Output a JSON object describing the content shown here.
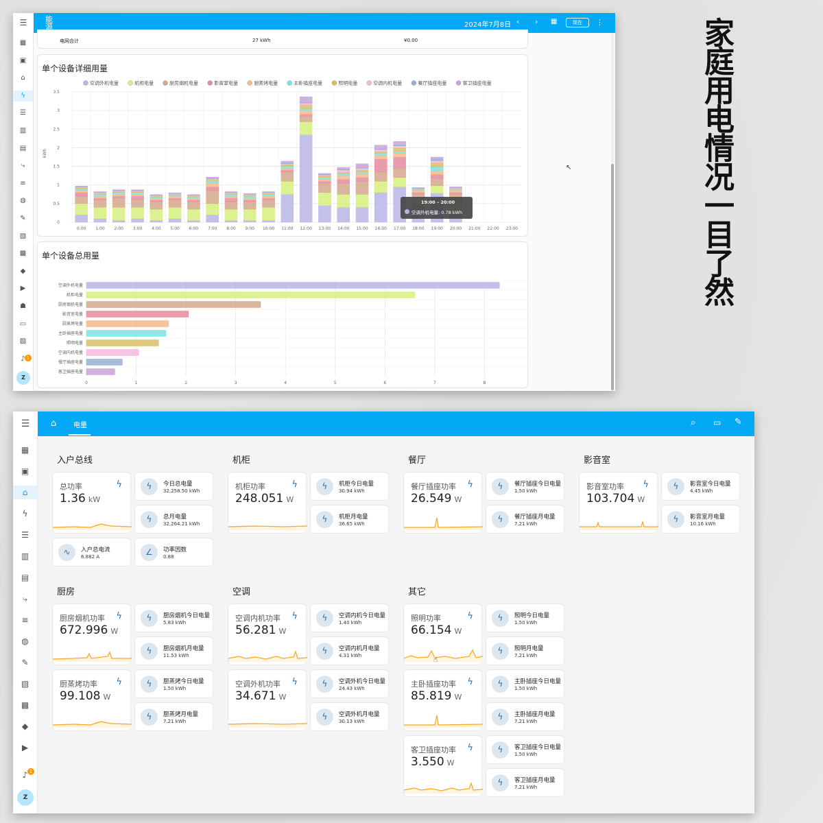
{
  "top_window": {
    "header": {
      "title": "能源",
      "date": "2024年7月8日",
      "now_button": "现在"
    },
    "summary": {
      "label": "电网合计",
      "energy": "27 kWh",
      "cost": "¥0.00"
    },
    "detail_chart": {
      "title": "单个设备详细用量"
    },
    "total_chart": {
      "title": "单个设备总用量"
    },
    "tooltip": {
      "time": "19:00 – 20:00",
      "label": "空调外机电量: 0.78 kWh"
    },
    "notification_count": "1",
    "user_initial": "Z"
  },
  "side_title": "家庭用电情况一目了然",
  "bottom_window": {
    "header": {
      "tab": "电量"
    },
    "notification_count": "1",
    "user_initial": "Z",
    "sections": [
      {
        "title": "入户总线",
        "big": [
          {
            "name": "总功率",
            "value": "1.36",
            "unit": "kW"
          }
        ],
        "small": [
          {
            "name": "今日总电量",
            "value": "32,258.50 kWh"
          },
          {
            "name": "总月电量",
            "value": "32,264.21 kWh"
          },
          {
            "name": "入户总电流",
            "value": "6.882 A"
          },
          {
            "name": "功率因数",
            "value": "0.88"
          }
        ]
      },
      {
        "title": "机柜",
        "big": [
          {
            "name": "机柜功率",
            "value": "248.051",
            "unit": "W"
          }
        ],
        "small": [
          {
            "name": "机柜今日电量",
            "value": "30.94 kWh"
          },
          {
            "name": "机柜月电量",
            "value": "36.65 kWh"
          }
        ]
      },
      {
        "title": "餐厅",
        "big": [
          {
            "name": "餐厅插座功率",
            "value": "26.549",
            "unit": "W"
          }
        ],
        "small": [
          {
            "name": "餐厅插座今日电量",
            "value": "1.50 kWh"
          },
          {
            "name": "餐厅插座月电量",
            "value": "7.21 kWh"
          }
        ]
      },
      {
        "title": "影音室",
        "big": [
          {
            "name": "影音室功率",
            "value": "103.704",
            "unit": "W"
          }
        ],
        "small": [
          {
            "name": "影音室今日电量",
            "value": "4.45 kWh"
          },
          {
            "name": "影音室月电量",
            "value": "10.16 kWh"
          }
        ]
      },
      {
        "title": "厨房",
        "big": [
          {
            "name": "厨房烟机功率",
            "value": "672.996",
            "unit": "W"
          },
          {
            "name": "厨蒸烤功率",
            "value": "99.108",
            "unit": "W"
          }
        ],
        "small": [
          {
            "name": "厨房烟机今日电量",
            "value": "5.83 kWh"
          },
          {
            "name": "厨房烟机月电量",
            "value": "11.53 kWh"
          },
          {
            "name": "厨蒸烤今日电量",
            "value": "1.50 kWh"
          },
          {
            "name": "厨蒸烤月电量",
            "value": "7.21 kWh"
          }
        ]
      },
      {
        "title": "空调",
        "big": [
          {
            "name": "空调内机功率",
            "value": "56.281",
            "unit": "W"
          },
          {
            "name": "空调外机功率",
            "value": "34.671",
            "unit": "W"
          }
        ],
        "small": [
          {
            "name": "空调内机今日电量",
            "value": "1.40 kWh"
          },
          {
            "name": "空调内机月电量",
            "value": "4.31 kWh"
          },
          {
            "name": "空调外机今日电量",
            "value": "24.43 kWh"
          },
          {
            "name": "空调外机月电量",
            "value": "30.13 kWh"
          }
        ]
      },
      {
        "title": "其它",
        "big": [
          {
            "name": "照明功率",
            "value": "66.154",
            "unit": "W"
          },
          {
            "name": "主卧插座功率",
            "value": "85.819",
            "unit": "W"
          },
          {
            "name": "客卫插座功率",
            "value": "3.550",
            "unit": "W"
          }
        ],
        "small": [
          {
            "name": "照明今日电量",
            "value": "1.50 kWh"
          },
          {
            "name": "照明月电量",
            "value": "7.21 kWh"
          },
          {
            "name": "主卧插座今日电量",
            "value": "1.50 kWh"
          },
          {
            "name": "主卧插座月电量",
            "value": "7.21 kWh"
          },
          {
            "name": "客卫插座今日电量",
            "value": "1.50 kWh"
          },
          {
            "name": "客卫插座月电量",
            "value": "7.21 kWh"
          }
        ]
      }
    ]
  },
  "chart_data": [
    {
      "type": "bar",
      "stacked": true,
      "title": "单个设备详细用量",
      "ylabel": "kWh",
      "ylim": [
        0,
        3.5
      ],
      "legend_position": "top",
      "categories": [
        "0:00",
        "1:00",
        "2:00",
        "3:00",
        "4:00",
        "5:00",
        "6:00",
        "7:00",
        "8:00",
        "9:00",
        "10:00",
        "11:00",
        "12:00",
        "13:00",
        "14:00",
        "15:00",
        "16:00",
        "17:00",
        "18:00",
        "19:00",
        "20:00",
        "21:00",
        "22:00",
        "23:00"
      ],
      "series": [
        {
          "name": "空调外机电量",
          "color": "#b9b5e6",
          "values": [
            0.2,
            0.1,
            0.05,
            0.1,
            0.05,
            0.1,
            0.05,
            0.2,
            0.05,
            0.05,
            0.05,
            0.75,
            2.35,
            0.45,
            0.4,
            0.4,
            0.8,
            0.95,
            0.45,
            0.78,
            0.2,
            0,
            0,
            0
          ]
        },
        {
          "name": "机柜电量",
          "color": "#d6f07c",
          "values": [
            0.3,
            0.3,
            0.35,
            0.3,
            0.3,
            0.3,
            0.3,
            0.3,
            0.3,
            0.3,
            0.35,
            0.35,
            0.35,
            0.35,
            0.35,
            0.35,
            0.3,
            0.25,
            0.2,
            0.2,
            0.3,
            0,
            0,
            0
          ]
        },
        {
          "name": "厨房烟机电量",
          "color": "#d4a78b",
          "values": [
            0.2,
            0.2,
            0.25,
            0.2,
            0.2,
            0.2,
            0.2,
            0.35,
            0.2,
            0.2,
            0.2,
            0.25,
            0.15,
            0.25,
            0.3,
            0.35,
            0.25,
            0.25,
            0.1,
            0.2,
            0.25,
            0,
            0,
            0
          ]
        },
        {
          "name": "影音室电量",
          "color": "#e58ba0",
          "values": [
            0.1,
            0.05,
            0.05,
            0.1,
            0.05,
            0.05,
            0.05,
            0.1,
            0.1,
            0.05,
            0.05,
            0.05,
            0.05,
            0.05,
            0.1,
            0.1,
            0.35,
            0.3,
            0.05,
            0.1,
            0.05,
            0,
            0,
            0
          ]
        },
        {
          "name": "厨蒸烤电量",
          "color": "#f7b98a",
          "values": [
            0.05,
            0.05,
            0.05,
            0.05,
            0.05,
            0.05,
            0.05,
            0.1,
            0.05,
            0.05,
            0.05,
            0.05,
            0.1,
            0.05,
            0.1,
            0.1,
            0.1,
            0.1,
            0.05,
            0.1,
            0.05,
            0,
            0,
            0
          ]
        },
        {
          "name": "主卧插座电量",
          "color": "#7be3e3",
          "values": [
            0.05,
            0.05,
            0.05,
            0.05,
            0.03,
            0.03,
            0.03,
            0.05,
            0.05,
            0.05,
            0.05,
            0.05,
            0.05,
            0.05,
            0.05,
            0.05,
            0.05,
            0.05,
            0.03,
            0.1,
            0.03,
            0,
            0,
            0
          ]
        },
        {
          "name": "照明电量",
          "color": "#d8bd69",
          "values": [
            0.03,
            0.03,
            0.03,
            0.03,
            0.02,
            0.02,
            0.02,
            0.05,
            0.03,
            0.03,
            0.03,
            0.05,
            0.1,
            0.05,
            0.05,
            0.05,
            0.05,
            0.1,
            0.02,
            0.12,
            0.02,
            0,
            0,
            0
          ]
        },
        {
          "name": "空调内机电量",
          "color": "#f5b8dc",
          "values": [
            0.02,
            0.02,
            0.02,
            0.02,
            0.02,
            0.02,
            0.02,
            0.02,
            0.02,
            0.02,
            0.02,
            0.02,
            0.05,
            0.02,
            0.05,
            0.05,
            0.05,
            0.05,
            0.01,
            0.05,
            0.02,
            0,
            0,
            0
          ]
        },
        {
          "name": "餐厅插座电量",
          "color": "#97aed2",
          "values": [
            0.01,
            0.01,
            0.01,
            0.01,
            0.01,
            0.01,
            0.01,
            0.02,
            0.01,
            0.01,
            0.01,
            0.02,
            0.02,
            0.02,
            0.02,
            0.02,
            0.02,
            0.02,
            0.01,
            0.05,
            0.01,
            0,
            0,
            0
          ]
        },
        {
          "name": "客卫插座电量",
          "color": "#c9a4d9",
          "values": [
            0.01,
            0.01,
            0.01,
            0.01,
            0.01,
            0.01,
            0.01,
            0.02,
            0.01,
            0.01,
            0.01,
            0.05,
            0.15,
            0.02,
            0.05,
            0.1,
            0.1,
            0.1,
            0.01,
            0.05,
            0.02,
            0,
            0,
            0
          ]
        }
      ]
    },
    {
      "type": "bar",
      "orientation": "horizontal",
      "title": "单个设备总用量",
      "xlabel": "kWh",
      "xlim": [
        0,
        9
      ],
      "categories": [
        "空调外机电量",
        "机柜电量",
        "厨房烟机电量",
        "影音室电量",
        "厨蒸烤电量",
        "主卧插座电量",
        "照明电量",
        "空调内机电量",
        "餐厅插座电量",
        "客卫插座电量"
      ],
      "values": [
        8.3,
        6.6,
        3.5,
        2.05,
        1.65,
        1.6,
        1.45,
        1.05,
        0.72,
        0.57
      ],
      "colors": [
        "#b9b5e6",
        "#d6f07c",
        "#d4a78b",
        "#e58ba0",
        "#f7b98a",
        "#7be3e3",
        "#d8bd69",
        "#f5b8dc",
        "#97aed2",
        "#c9a4d9"
      ]
    }
  ]
}
